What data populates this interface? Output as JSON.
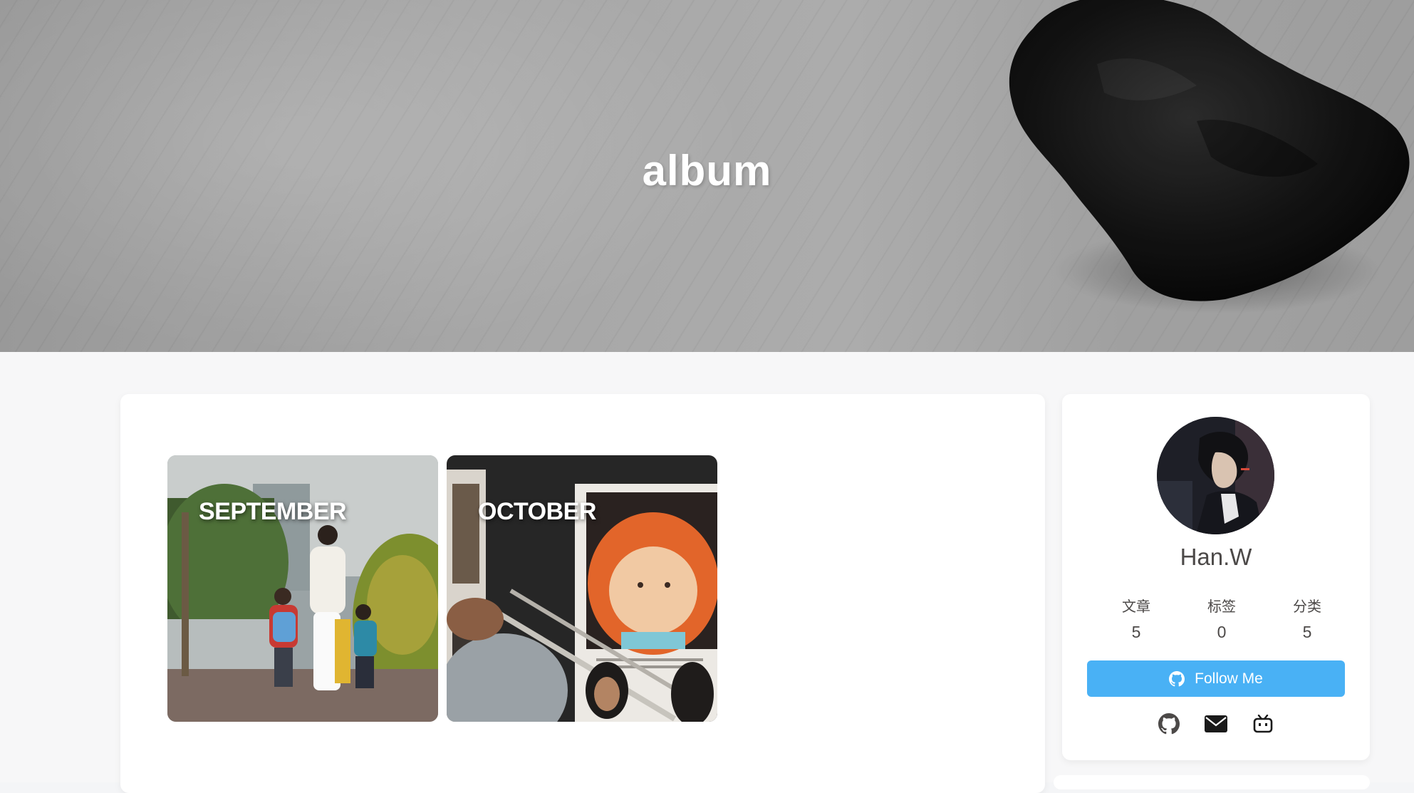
{
  "hero": {
    "title": "album"
  },
  "albums": [
    {
      "label": "SEPTEMBER"
    },
    {
      "label": "OCTOBER"
    }
  ],
  "author": {
    "name": "Han.W",
    "stats": [
      {
        "label": "文章",
        "value": "5"
      },
      {
        "label": "标签",
        "value": "0"
      },
      {
        "label": "分类",
        "value": "5"
      }
    ],
    "follow_label": "Follow Me",
    "follow_icon": "github-icon",
    "social_icons": [
      "github-icon",
      "envelope-icon",
      "bilibili-icon"
    ]
  },
  "colors": {
    "accent": "#49b1f5",
    "text": "#4c4948",
    "card": "#ffffff"
  }
}
